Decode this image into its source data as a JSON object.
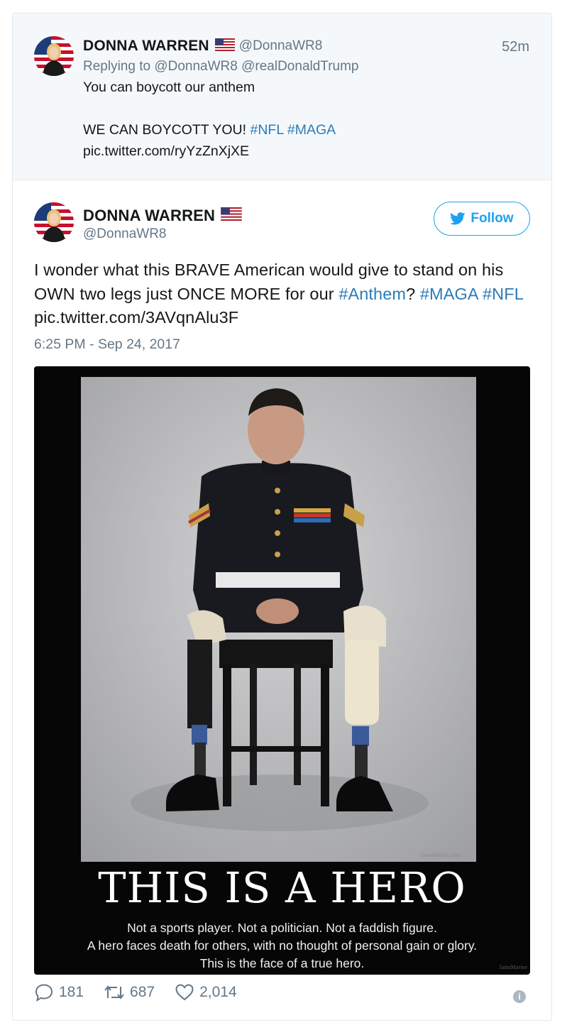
{
  "parent_tweet": {
    "name": "DONNA WARREN",
    "flag": "us-flag-emoji",
    "handle": "@DonnaWR8",
    "time": "52m",
    "replying_label": "Replying to",
    "replying_to": "@DonnaWR8 @realDonaldTrump",
    "text_line1": "You can boycott our anthem",
    "text_line2": "WE CAN BOYCOTT YOU!",
    "hashtag1": "#NFL",
    "hashtag2": "#MAGA",
    "pic_link": "pic.twitter.com/ryYzZnXjXE"
  },
  "main_tweet": {
    "name": "DONNA WARREN",
    "flag": "us-flag-emoji",
    "handle": "@DonnaWR8",
    "follow_label": "Follow",
    "line1": "I wonder what this BRAVE American would give to stand on his",
    "line2_text": "OWN two legs just ONCE MORE for our",
    "hashtag_anthem": "#Anthem",
    "qmark": "?",
    "hashtag_maga": "#MAGA",
    "hashtag_nfl": "#NFL",
    "pic_link": "pic.twitter.com/3AVqnAlu3F",
    "timestamp": "6:25 PM - Sep 24, 2017"
  },
  "media": {
    "poster_title": "THIS IS A HERO",
    "caption_line1": "Not a sports player.  Not a politician.  Not a faddish figure.",
    "caption_line2": "A hero faces death for others, with no thought of personal gain or glory.",
    "caption_line3": "This is the face of a true hero.",
    "watermark_photo": "IamaMarine.com",
    "watermark_poster": "IamaMarine"
  },
  "actions": {
    "replies": "181",
    "retweets": "687",
    "likes": "2,014"
  },
  "colors": {
    "link": "#1b95e0",
    "hashtag": "#2b7bb9",
    "follow": "#1da1f2",
    "muted": "#657786",
    "parent_bg": "#f5f8fa"
  }
}
